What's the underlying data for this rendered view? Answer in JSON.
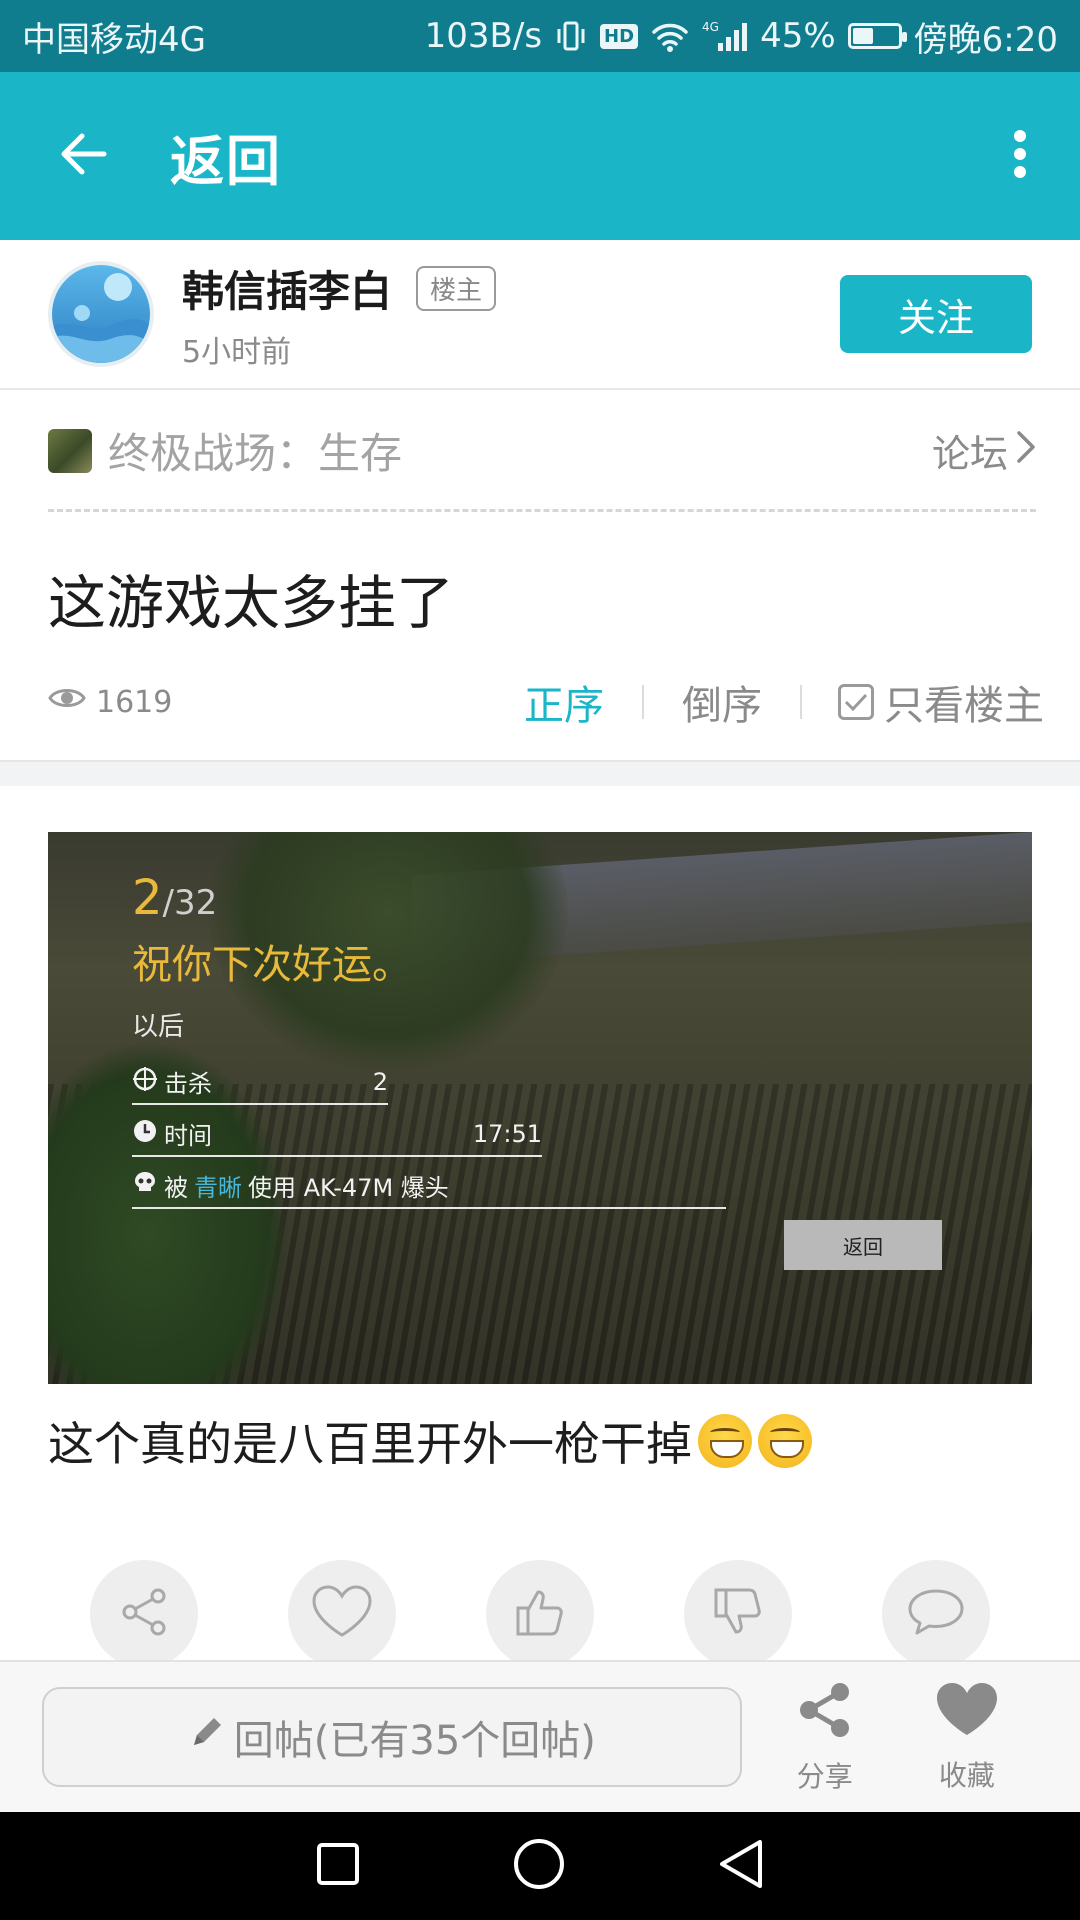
{
  "status_bar": {
    "carrier": "中国移动4G",
    "speed": "103B/s",
    "hd": "HD",
    "network": "4G",
    "battery_percent_text": "45%",
    "battery_level": 0.45,
    "time": "傍晚6:20"
  },
  "app_bar": {
    "title": "返回",
    "back_icon": "arrow-left-icon",
    "more_icon": "more-vertical-icon",
    "background": "#1ab6c7"
  },
  "author": {
    "name": "韩信插李白",
    "badge": "楼主",
    "time": "5小时前",
    "follow_label": "关注"
  },
  "forum": {
    "name": "终极战场：生存",
    "link_label": "论坛"
  },
  "post": {
    "title": "这游戏太多挂了",
    "views": "1619",
    "text": "这个真的是八百里开外一枪干掉",
    "emojis": [
      "grinning-face-icon",
      "grinning-face-icon"
    ]
  },
  "sort": {
    "asc": "正序",
    "desc": "倒序",
    "op_only": "只看楼主",
    "active": "正序"
  },
  "game_screenshot": {
    "rank": "2",
    "total": "/32",
    "message": "祝你下次好运。",
    "later": "以后",
    "kills_label": "击杀",
    "kills_value": "2",
    "time_label": "时间",
    "time_value": "17:51",
    "death_prefix": "被",
    "killer": "青晰",
    "death_suffix": "使用 AK-47M 爆头",
    "back_button": "返回"
  },
  "actions": [
    "share-icon",
    "heart-icon",
    "thumbs-up-icon",
    "thumbs-down-icon",
    "comment-icon"
  ],
  "bottom_bar": {
    "reply_placeholder": "回帖(已有35个回帖)",
    "share_label": "分享",
    "favorite_label": "收藏"
  },
  "nav": [
    "square-icon",
    "circle-icon",
    "triangle-back-icon"
  ],
  "colors": {
    "accent": "#1ab6c7",
    "status_bar": "#0f7d8e"
  }
}
